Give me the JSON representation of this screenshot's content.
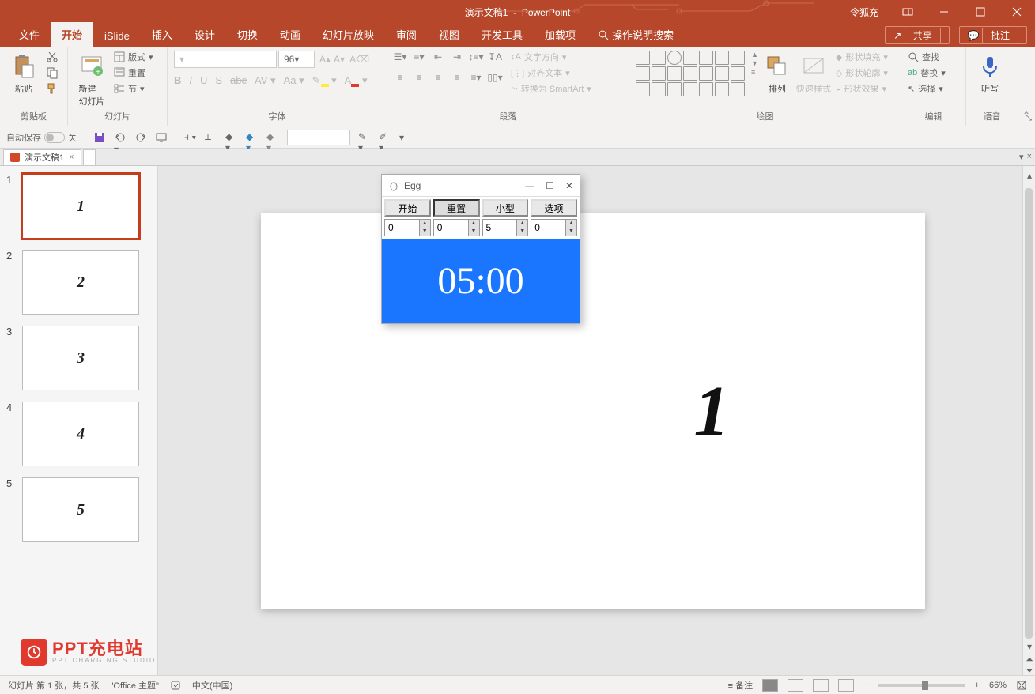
{
  "title": {
    "doc": "演示文稿1",
    "app": "PowerPoint",
    "account": "令狐充"
  },
  "tabs": {
    "file": "文件",
    "home": "开始",
    "islide": "iSlide",
    "insert": "插入",
    "design": "设计",
    "transitions": "切换",
    "animations": "动画",
    "slideshow": "幻灯片放映",
    "review": "审阅",
    "view": "视图",
    "dev": "开发工具",
    "addins": "加载项",
    "tellme": "操作说明搜索",
    "share": "共享",
    "comments": "批注"
  },
  "groups": {
    "clipboard": "剪贴板",
    "paste": "粘贴",
    "slides": "幻灯片",
    "newslide": "新建\n幻灯片",
    "layout": "版式",
    "reset": "重置",
    "section": "节",
    "font": "字体",
    "fontsize": "96",
    "paragraph": "段落",
    "textdir": "文字方向",
    "align": "对齐文本",
    "smartart": "转换为 SmartArt",
    "drawing": "绘图",
    "arrange": "排列",
    "quickstyle": "快速样式",
    "shapefill": "形状填充",
    "shapeoutline": "形状轮廓",
    "shapeeffect": "形状效果",
    "editing": "编辑",
    "find": "查找",
    "replace": "替换",
    "select": "选择",
    "voice": "语音",
    "dictate": "听写"
  },
  "qat": {
    "autosave": "自动保存",
    "off": "关"
  },
  "doctab": {
    "name": "演示文稿1"
  },
  "thumbnails": [
    {
      "num": "1",
      "label": "1",
      "active": true
    },
    {
      "num": "2",
      "label": "2",
      "active": false
    },
    {
      "num": "3",
      "label": "3",
      "active": false
    },
    {
      "num": "4",
      "label": "4",
      "active": false
    },
    {
      "num": "5",
      "label": "5",
      "active": false
    }
  ],
  "slide": {
    "content": "1"
  },
  "egg": {
    "title": "Egg",
    "buttons": {
      "start": "开始",
      "reset": "重置",
      "small": "小型",
      "options": "选项"
    },
    "spins": {
      "v1": "0",
      "v2": "0",
      "v3": "5",
      "v4": "0"
    },
    "display": "05:00"
  },
  "status": {
    "slideinfo": "幻灯片 第 1 张，共 5 张",
    "theme": "\"Office 主题\"",
    "lang": "中文(中国)",
    "notes": "备注",
    "zoom": "66%"
  },
  "watermark": {
    "line1": "PPT充电站",
    "line2": "PPT CHARGING STUDIO"
  }
}
